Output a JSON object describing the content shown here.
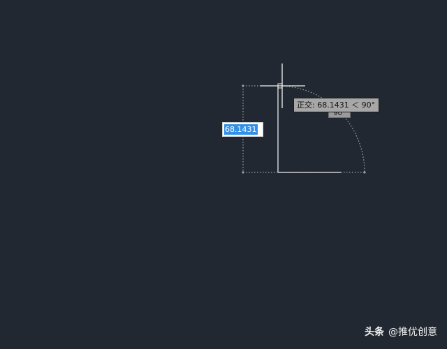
{
  "cad": {
    "dynamic_input": {
      "value": "68.1431"
    },
    "angle_dimension": {
      "value": "90°"
    },
    "ortho_tooltip": {
      "text": "正交: 68.1431 ＜ 90°"
    }
  },
  "watermark": {
    "brand": "头条",
    "handle": "@推优创意"
  },
  "colors": {
    "background": "#222831",
    "line": "#e8e8e8",
    "dotted_guide": "#9aa0a6",
    "selection": "#3390e6",
    "tooltip_bg": "#a7a7a7"
  }
}
